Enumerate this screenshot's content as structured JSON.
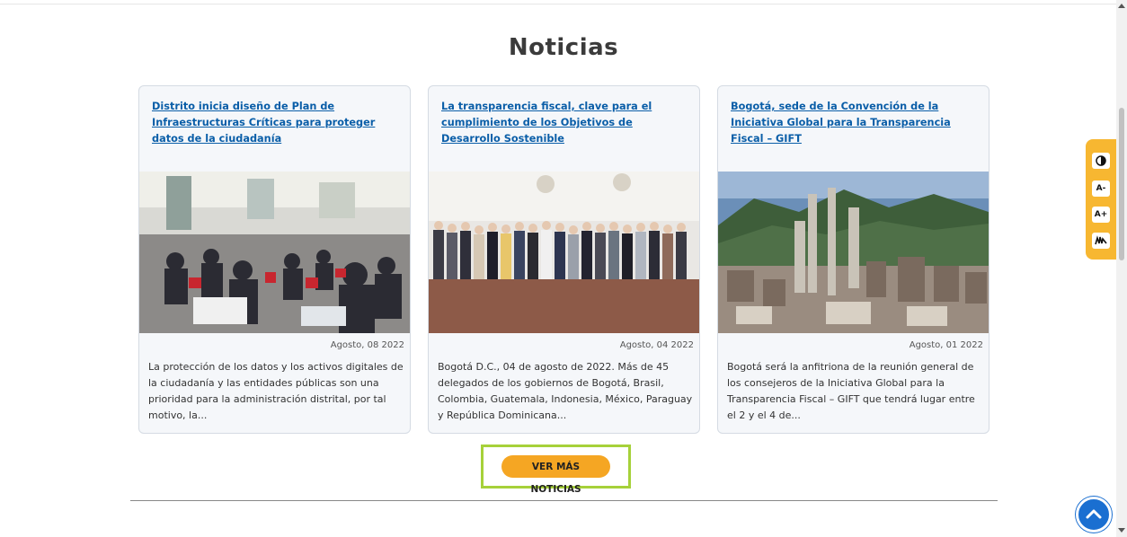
{
  "section": {
    "title": "Noticias"
  },
  "news": [
    {
      "title": "Distrito inicia diseño de Plan de Infraestructuras Críticas para proteger datos de la ciudadanía",
      "date": "Agosto, 08 2022",
      "excerpt": "La protección de los datos y los activos digitales de la ciudadanía y las entidades públicas son una prioridad para la administración distrital, por tal motivo, la..."
    },
    {
      "title": "La transparencia fiscal, clave para el cumplimiento de los Objetivos de Desarrollo Sostenible",
      "date": "Agosto, 04 2022",
      "excerpt": "Bogotá D.C., 04 de agosto de 2022. Más de 45 delegados de los gobiernos de Bogotá, Brasil, Colombia, Guatemala, Indonesia, México, Paraguay y República Dominicana..."
    },
    {
      "title": "Bogotá, sede de la Convención de la Iniciativa Global para la Transparencia Fiscal – GIFT",
      "date": "Agosto, 01 2022",
      "excerpt": "Bogotá será la anfitriona de la reunión general de los consejeros de la Iniciativa Global para la Transparencia Fiscal – GIFT que tendrá lugar entre el 2 y el 4 de..."
    }
  ],
  "more_button": {
    "label": "VER MÁS NOTICIAS"
  },
  "accessibility": {
    "contrast_icon": "contrast-icon",
    "decrease_label": "A-",
    "increase_label": "A+",
    "sign_language_icon": "sign-language-icon"
  },
  "colors": {
    "link": "#0a5ea8",
    "button": "#f5a623",
    "highlight": "#a6d13a",
    "accessibility_bar": "#f7b731",
    "back_to_top": "#1a6fd1"
  }
}
